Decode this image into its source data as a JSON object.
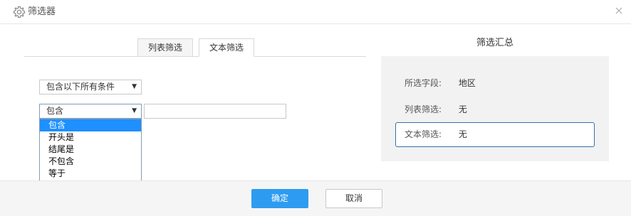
{
  "dialog": {
    "title": "筛选器",
    "title_icon": "gear-icon",
    "close_icon": "close-icon"
  },
  "tabs": [
    {
      "label": "列表筛选",
      "active": false
    },
    {
      "label": "文本筛选",
      "active": true
    }
  ],
  "filter": {
    "mode_select": {
      "value": "包含以下所有条件",
      "arrow": "▼"
    },
    "operator_select": {
      "value": "包含",
      "arrow": "▼"
    },
    "text_input": {
      "value": "",
      "placeholder": ""
    },
    "operator_options": [
      {
        "label": "包含",
        "selected": true
      },
      {
        "label": "开头是",
        "selected": false
      },
      {
        "label": "结尾是",
        "selected": false
      },
      {
        "label": "不包含",
        "selected": false
      },
      {
        "label": "等于",
        "selected": false
      }
    ]
  },
  "summary": {
    "title": "筛选汇总",
    "field_label": "所选字段:",
    "field_value": "地区",
    "list_label": "列表筛选:",
    "list_value": "无",
    "text_label": "文本筛选:",
    "text_value": "无"
  },
  "footer": {
    "ok_label": "确定",
    "cancel_label": "取消"
  },
  "colors": {
    "accent": "#2d9cf0",
    "dropdown_highlight": "#1e90ff",
    "summary_bg": "#f2f2f2",
    "summary_box_border": "#3a6ea5"
  }
}
